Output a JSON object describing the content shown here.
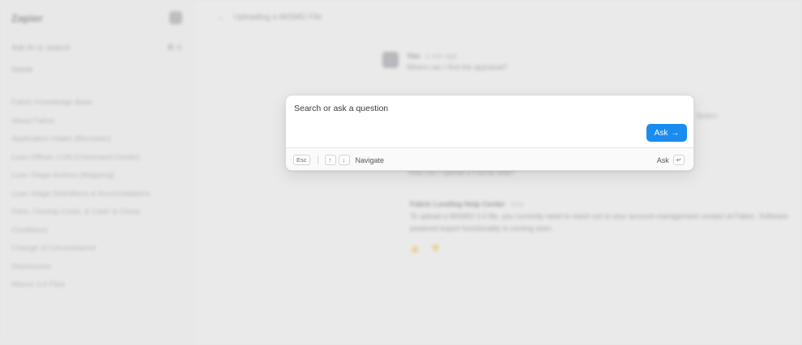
{
  "background": {
    "logo": "Zapier",
    "sidebar_search": "Ask AI or search",
    "sidebar_search_shortcut": "⌘ K",
    "sidebar_home": "Home",
    "sidebar_items": [
      "Fabric Knowledge Base",
      "About Fabric",
      "Application Intake (Borrower)",
      "Loan Officer, LOA (Command Center)",
      "Loan Stage Actions (Mapping)",
      "Loan Stage Definitions & Accomodations",
      "Fees, Closing Costs, & Cash to Close",
      "Conditions",
      "Change of Circumstance",
      "Disclosures",
      "Mismo 3.4 Files"
    ],
    "thread_title": "Uploading a MISMO File",
    "user_name": "You",
    "user_time": "1 min ago",
    "user_message": "Where can I find the appraisal?",
    "side_snippet": "ibution",
    "user_message_2": "How can I upload a Fannie Mae?",
    "answer_title": "Fabric Lending Help Center",
    "answer_time": "now",
    "answer_text": "To upload a MISMO 3.4 file, you currently need to reach out to your account management contact at Fabric. Software-powered import functionality is coming soon.",
    "answer_icons": "👍 👎"
  },
  "palette": {
    "search_placeholder": "Search or ask a question",
    "ask_button_label": "Ask",
    "ask_button_arrow": "→",
    "footer": {
      "esc_key": "Esc",
      "up_key": "↑",
      "down_key": "↓",
      "navigate_label": "Navigate",
      "ask_label": "Ask",
      "enter_key": "↵"
    }
  },
  "colors": {
    "accent": "#1a8cf0",
    "background": "#e8e8e8"
  }
}
